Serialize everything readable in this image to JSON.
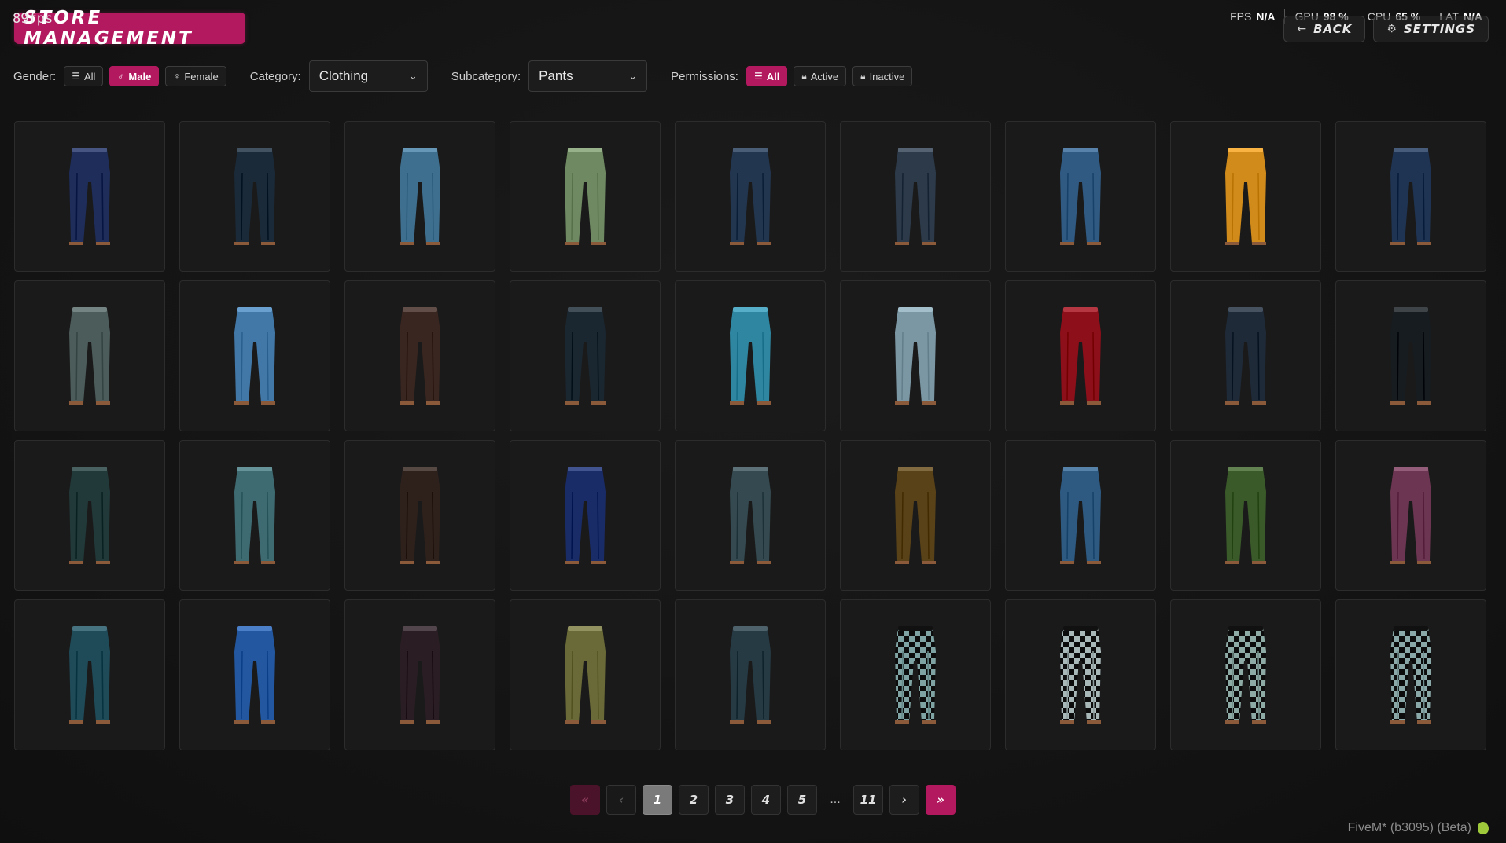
{
  "overlay": {
    "fps_counter": "89fps"
  },
  "header": {
    "title": "STORE MANAGEMENT",
    "back_label": "BACK",
    "settings_label": "SETTINGS"
  },
  "perf": [
    {
      "label": "FPS",
      "value": "N/A"
    },
    {
      "label": "GPU",
      "value": "98 %"
    },
    {
      "label": "CPU",
      "value": "65 %"
    },
    {
      "label": "LAT",
      "value": "N/A"
    }
  ],
  "filters": {
    "gender_label": "Gender:",
    "gender_options": [
      "All",
      "Male",
      "Female"
    ],
    "category_label": "Category:",
    "category_value": "Clothing",
    "subcategory_label": "Subcategory:",
    "subcategory_value": "Pants",
    "permissions_label": "Permissions:",
    "permission_options": [
      "All",
      "Active",
      "Inactive"
    ]
  },
  "items": [
    {
      "color": "#1e2d5a",
      "pattern": "solid"
    },
    {
      "color": "#1a2a38",
      "pattern": "solid"
    },
    {
      "color": "#3f6f8e",
      "pattern": "solid"
    },
    {
      "color": "#6f8a62",
      "pattern": "solid"
    },
    {
      "color": "#23364f",
      "pattern": "solid"
    },
    {
      "color": "#2c3a4a",
      "pattern": "solid"
    },
    {
      "color": "#305a82",
      "pattern": "solid"
    },
    {
      "color": "#d08b1a",
      "pattern": "solid"
    },
    {
      "color": "#1f3452",
      "pattern": "solid"
    },
    {
      "color": "#4c5c5a",
      "pattern": "solid"
    },
    {
      "color": "#4278a8",
      "pattern": "solid"
    },
    {
      "color": "#3a2620",
      "pattern": "solid"
    },
    {
      "color": "#1b2730",
      "pattern": "solid"
    },
    {
      "color": "#2f86a0",
      "pattern": "solid"
    },
    {
      "color": "#7c97a4",
      "pattern": "solid"
    },
    {
      "color": "#8c0f1a",
      "pattern": "solid"
    },
    {
      "color": "#1f2a38",
      "pattern": "solid"
    },
    {
      "color": "#171c20",
      "pattern": "solid"
    },
    {
      "color": "#22393a",
      "pattern": "solid"
    },
    {
      "color": "#3e6a72",
      "pattern": "solid"
    },
    {
      "color": "#2e211c",
      "pattern": "solid"
    },
    {
      "color": "#1a2c68",
      "pattern": "solid"
    },
    {
      "color": "#344a50",
      "pattern": "solid"
    },
    {
      "color": "#5a4218",
      "pattern": "solid"
    },
    {
      "color": "#2e5a82",
      "pattern": "solid"
    },
    {
      "color": "#3a5a2a",
      "pattern": "solid"
    },
    {
      "color": "#6c3652",
      "pattern": "solid"
    },
    {
      "color": "#1f4a58",
      "pattern": "solid"
    },
    {
      "color": "#2358a0",
      "pattern": "solid"
    },
    {
      "color": "#2a1e24",
      "pattern": "solid"
    },
    {
      "color": "#6a6a38",
      "pattern": "solid"
    },
    {
      "color": "#263a44",
      "pattern": "solid"
    },
    {
      "color": "#7fa3a3",
      "pattern": "checker"
    },
    {
      "color": "#a8b8b8",
      "pattern": "checker"
    },
    {
      "color": "#8eaaa4",
      "pattern": "checker"
    },
    {
      "color": "#8aa8a8",
      "pattern": "checker"
    }
  ],
  "pagination": {
    "first": "«",
    "prev": "‹",
    "pages": [
      "1",
      "2",
      "3",
      "4",
      "5"
    ],
    "ellipsis": "...",
    "last_page": "11",
    "next": "›",
    "last": "»",
    "current": "1"
  },
  "build": {
    "label": "FiveM* (b3095) (Beta)"
  },
  "colors": {
    "accent": "#b3195f"
  }
}
